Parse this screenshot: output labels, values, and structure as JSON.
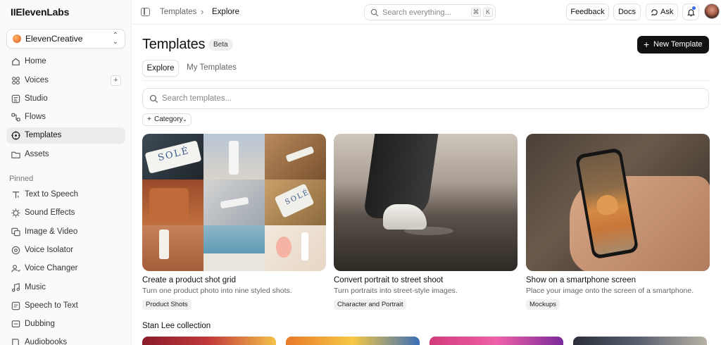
{
  "brand": {
    "logo": "IIElevenLabs"
  },
  "workspace": {
    "name": "ElevenCreative"
  },
  "sidebar": {
    "items": [
      {
        "label": "Home",
        "icon": "home-icon"
      },
      {
        "label": "Voices",
        "icon": "voices-icon"
      },
      {
        "label": "Studio",
        "icon": "studio-icon"
      },
      {
        "label": "Flows",
        "icon": "flows-icon"
      },
      {
        "label": "Templates",
        "icon": "templates-icon",
        "active": true
      },
      {
        "label": "Assets",
        "icon": "folder-icon"
      }
    ],
    "pinned_label": "Pinned",
    "pinned": [
      {
        "label": "Text to Speech",
        "icon": "tts-icon"
      },
      {
        "label": "Sound Effects",
        "icon": "sound-effects-icon"
      },
      {
        "label": "Image & Video",
        "icon": "image-video-icon"
      },
      {
        "label": "Voice Isolator",
        "icon": "voice-isolator-icon"
      },
      {
        "label": "Voice Changer",
        "icon": "voice-changer-icon"
      },
      {
        "label": "Music",
        "icon": "music-icon"
      },
      {
        "label": "Speech to Text",
        "icon": "speech-to-text-icon"
      },
      {
        "label": "Dubbing",
        "icon": "dubbing-icon"
      },
      {
        "label": "Audiobooks",
        "icon": "audiobooks-icon"
      }
    ]
  },
  "topbar": {
    "breadcrumb": [
      "Templates",
      "Explore"
    ],
    "breadcrumb_sep": "›",
    "search_placeholder": "Search everything...",
    "shortcut": [
      "⌘",
      "K"
    ],
    "feedback": "Feedback",
    "docs": "Docs",
    "ask": "Ask"
  },
  "page": {
    "title": "Templates",
    "badge": "Beta",
    "new_button": "New Template",
    "tabs": [
      "Explore",
      "My Templates"
    ],
    "search_placeholder": "Search templates...",
    "category_filter": "Category"
  },
  "cards": [
    {
      "title": "Create a product shot grid",
      "description": "Turn one product photo into nine styled shots.",
      "tag": "Product Shots"
    },
    {
      "title": "Convert portrait to street shoot",
      "description": "Turn portraits into street-style images.",
      "tag": "Character and Portrait"
    },
    {
      "title": "Show on a smartphone screen",
      "description": "Place your image onto the screen of a smartphone.",
      "tag": "Mockups"
    }
  ],
  "product_brand_text": "SOLÉ",
  "collection": {
    "title": "Stan Lee collection"
  },
  "colors": {
    "primary_button": "#111111",
    "active_nav": "#ececec",
    "notification_dot": "#3b6cf6"
  }
}
